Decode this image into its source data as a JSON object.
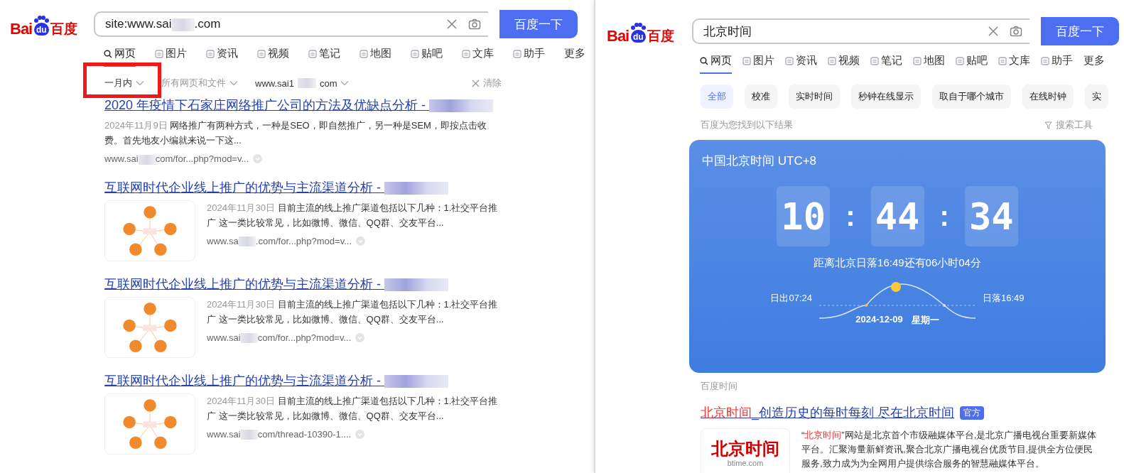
{
  "left": {
    "logo": {
      "bai": "Bai",
      "du": "du",
      "cn": "百度"
    },
    "search": {
      "value": "site:www.sai",
      "value_tail": ".com",
      "button": "百度一下"
    },
    "tabs": [
      {
        "label": "网页",
        "kind": "search",
        "selected": true
      },
      {
        "label": "图片",
        "kind": "icon",
        "selected": false
      },
      {
        "label": "资讯",
        "kind": "icon",
        "selected": false
      },
      {
        "label": "视频",
        "kind": "icon",
        "selected": false
      },
      {
        "label": "笔记",
        "kind": "icon",
        "selected": false
      },
      {
        "label": "地图",
        "kind": "icon",
        "selected": false
      },
      {
        "label": "贴吧",
        "kind": "icon",
        "selected": false
      },
      {
        "label": "文库",
        "kind": "icon",
        "selected": false
      },
      {
        "label": "助手",
        "kind": "icon",
        "selected": false
      },
      {
        "label": "更多",
        "kind": "text",
        "selected": false
      }
    ],
    "filters": [
      {
        "label": "一月内",
        "highlighted": true
      },
      {
        "label": "所有网页和文件",
        "highlighted": false
      },
      {
        "label": "www.sai1",
        "tail": "com",
        "highlighted": false
      }
    ],
    "clear": "清除",
    "results": [
      {
        "title": "2020 年疫情下石家庄网络推广公司的方法及优缺点分析 -",
        "date": "2024年11月9日",
        "snippet": "网络推广有两种方式，一种是SEO，即自然推广，另一种是SEM，即按点击收费。首先地友小编就来说一下这...",
        "url": "www.sai",
        "url_tail": "com/for...php?mod=v...",
        "thumbnail": false
      },
      {
        "title": "互联网时代企业线上推广的优势与主流渠道分析 -",
        "date": "2024年11月30日",
        "snippet": "目前主流的线上推广渠道包括以下几种：1.社交平台推广 这一类比较常见，比如微博、微信、QQ群、交友平台...",
        "url": "www.sa",
        "url_tail": ".com/for...php?mod=v...",
        "thumbnail": true
      },
      {
        "title": "互联网时代企业线上推广的优势与主流渠道分析 -",
        "date": "2024年11月30日",
        "snippet": "目前主流的线上推广渠道包括以下几种：1.社交平台推广 这一类比较常见，比如微博、微信、QQ群、交友平台...",
        "url": "www.sai",
        "url_tail": "com/for...php?mod=v...",
        "thumbnail": true
      },
      {
        "title": "互联网时代企业线上推广的优势与主流渠道分析 -",
        "date": "2024年11月30日",
        "snippet": "目前主流的线上推广渠道包括以下几种：1.社交平台推广 这一类比较常见，比如微博、微信、QQ群、交友平台...",
        "url": "www.sai",
        "url_tail": "com/thread-10390-1....",
        "thumbnail": true
      }
    ]
  },
  "right": {
    "logo": {
      "bai": "Bai",
      "du": "du",
      "cn": "百度"
    },
    "search": {
      "value": "北京时间",
      "button": "百度一下"
    },
    "tabs": [
      {
        "label": "网页",
        "kind": "search",
        "selected": true
      },
      {
        "label": "图片",
        "kind": "icon",
        "selected": false
      },
      {
        "label": "资讯",
        "kind": "icon",
        "selected": false
      },
      {
        "label": "视频",
        "kind": "icon",
        "selected": false
      },
      {
        "label": "笔记",
        "kind": "icon",
        "selected": false
      },
      {
        "label": "地图",
        "kind": "icon",
        "selected": false
      },
      {
        "label": "贴吧",
        "kind": "icon",
        "selected": false
      },
      {
        "label": "文库",
        "kind": "icon",
        "selected": false
      },
      {
        "label": "助手",
        "kind": "icon",
        "selected": false
      },
      {
        "label": "更多",
        "kind": "text",
        "selected": false
      }
    ],
    "chips": [
      {
        "label": "全部",
        "selected": true
      },
      {
        "label": "校准",
        "selected": false
      },
      {
        "label": "实时时间",
        "selected": false
      },
      {
        "label": "秒钟在线显示",
        "selected": false
      },
      {
        "label": "取自于哪个城市",
        "selected": false
      },
      {
        "label": "在线时钟",
        "selected": false
      },
      {
        "label": "实",
        "selected": false
      }
    ],
    "result_note": "百度为您找到以下结果",
    "search_tools": "搜索工具",
    "clock": {
      "title": "中国北京时间 UTC+8",
      "hours": "10",
      "minutes": "44",
      "seconds": "34",
      "separator": ":",
      "countdown": "距离北京日落16:49还有06小时04分",
      "sunrise": "日出07:24",
      "sunset": "日落16:49",
      "date": "2024-12-09",
      "weekday": "星期一"
    },
    "source": "百度时间",
    "result": {
      "title_highlight": "北京时间",
      "title_rest": "_创造历史的每时每刻 尽在北京时间",
      "badge": "官方",
      "snippet_open": "“",
      "snippet_highlight": "北京时间",
      "snippet_rest": "”网站是北京首个市级融媒体平台,是北京广播电视台重要新媒体平台。汇聚海量新鲜资讯,聚合北京广播电视台优质节目,提供全方位便民服务,致力成为为全网用户提供综合服务的智慧融媒体平台。",
      "logo_text": "北京时间",
      "logo_sub": "btime.com"
    }
  }
}
